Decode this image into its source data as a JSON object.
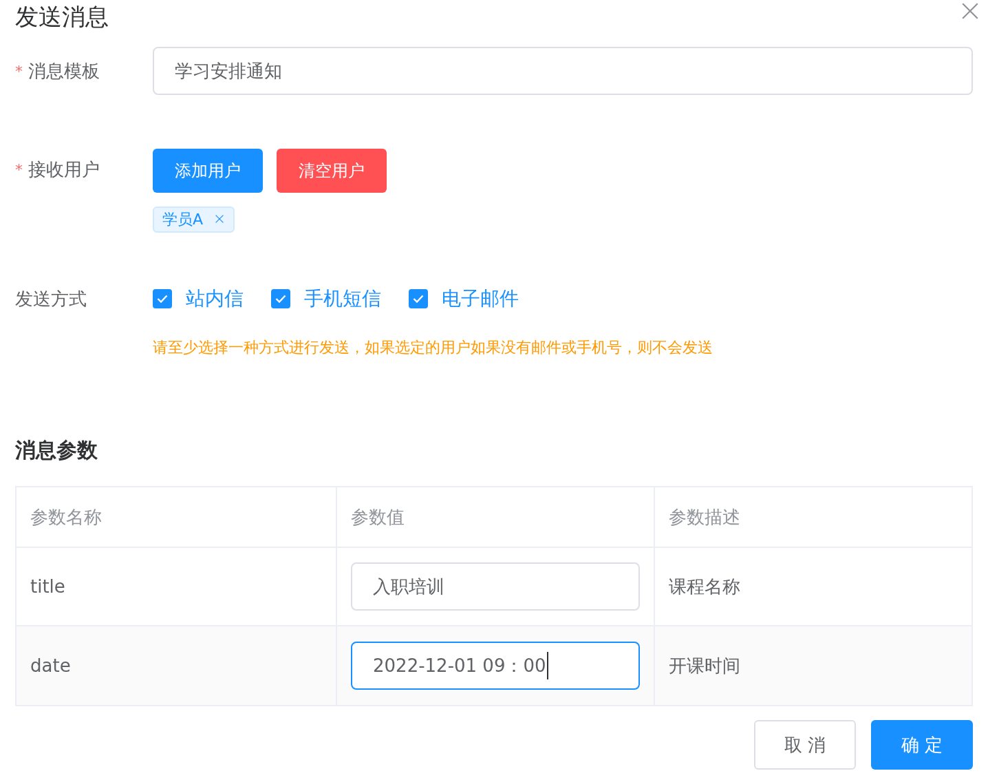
{
  "dialog": {
    "title": "发送消息"
  },
  "form": {
    "template": {
      "asterisk": "*",
      "label": "消息模板",
      "value": "学习安排通知"
    },
    "receivers": {
      "asterisk": "*",
      "label": "接收用户",
      "buttons": [
        {
          "label": "添加用户",
          "kind": "primary"
        },
        {
          "label": "清空用户",
          "kind": "danger"
        }
      ],
      "tags": [
        "学员A"
      ]
    },
    "methods": {
      "label": "发送方式",
      "options": [
        {
          "label": "站内信",
          "checked": true
        },
        {
          "label": "手机短信",
          "checked": true
        },
        {
          "label": "电子邮件",
          "checked": true
        }
      ],
      "hint": "请至少选择一种方式进行发送，如果选定的用户如果没有邮件或手机号，则不会发送"
    }
  },
  "params": {
    "title": "消息参数",
    "columns": [
      "参数名称",
      "参数值",
      "参数描述"
    ],
    "rows": [
      {
        "name": "title",
        "value": "入职培训",
        "focused": false,
        "description": "课程名称"
      },
      {
        "name": "date",
        "value": "2022-12-01 09：00",
        "focused": true,
        "description": "开课时间"
      }
    ]
  },
  "footer": {
    "buttons": [
      {
        "label": "取 消",
        "kind": "default"
      },
      {
        "label": "确 定",
        "kind": "primary"
      }
    ]
  }
}
